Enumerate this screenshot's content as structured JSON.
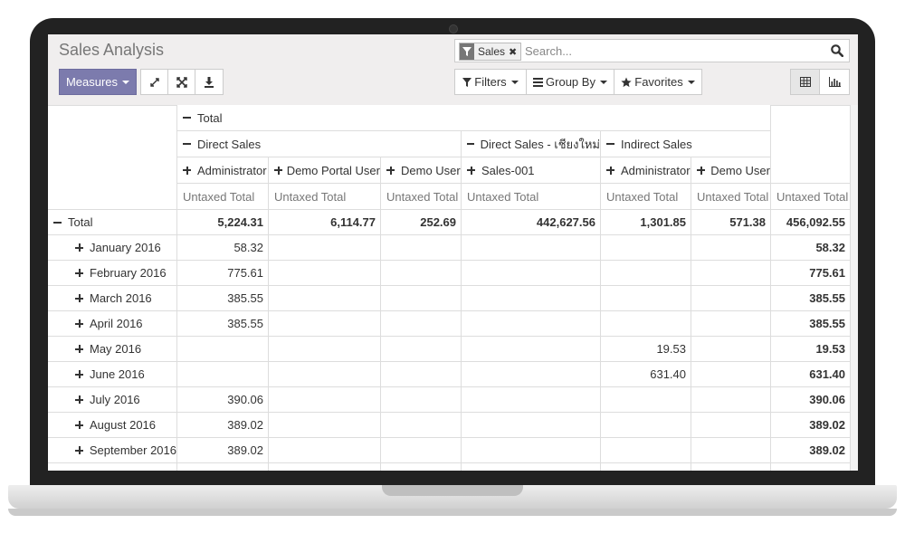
{
  "app": {
    "title": "Sales Analysis"
  },
  "toolbar": {
    "measures_label": "Measures",
    "filters_label": "Filters",
    "group_by_label": "Group By",
    "favorites_label": "Favorites"
  },
  "search": {
    "facet_value": "Sales",
    "placeholder": "Search..."
  },
  "pivot": {
    "col_total_label": "Total",
    "col_groups": [
      {
        "label": "Direct Sales",
        "expanded": true
      },
      {
        "label": "Direct Sales - เชียงใหม่",
        "expanded": true
      },
      {
        "label": "Indirect Sales",
        "expanded": true
      }
    ],
    "col_subs": [
      "Administrator",
      "Demo Portal User",
      "Demo User",
      "Sales-001",
      "Administrator",
      "Demo User"
    ],
    "measure_label": "Untaxed Total",
    "row_total_label": "Total",
    "total_row": [
      "5,224.31",
      "6,114.77",
      "252.69",
      "442,627.56",
      "1,301.85",
      "571.38",
      "456,092.55"
    ],
    "rows": [
      {
        "label": "January 2016",
        "values": [
          "58.32",
          "",
          "",
          "",
          "",
          "",
          "58.32"
        ]
      },
      {
        "label": "February 2016",
        "values": [
          "775.61",
          "",
          "",
          "",
          "",
          "",
          "775.61"
        ]
      },
      {
        "label": "March 2016",
        "values": [
          "385.55",
          "",
          "",
          "",
          "",
          "",
          "385.55"
        ]
      },
      {
        "label": "April 2016",
        "values": [
          "385.55",
          "",
          "",
          "",
          "",
          "",
          "385.55"
        ]
      },
      {
        "label": "May 2016",
        "values": [
          "",
          "",
          "",
          "",
          "19.53",
          "",
          "19.53"
        ]
      },
      {
        "label": "June 2016",
        "values": [
          "",
          "",
          "",
          "",
          "631.40",
          "",
          "631.40"
        ]
      },
      {
        "label": "July 2016",
        "values": [
          "390.06",
          "",
          "",
          "",
          "",
          "",
          "390.06"
        ]
      },
      {
        "label": "August 2016",
        "values": [
          "389.02",
          "",
          "",
          "",
          "",
          "",
          "389.02"
        ]
      },
      {
        "label": "September 2016",
        "values": [
          "389.02",
          "",
          "",
          "",
          "",
          "",
          "389.02"
        ]
      }
    ]
  },
  "colors": {
    "primary": "#7c7bad",
    "border": "#dddddd",
    "panel": "#f0eeee",
    "muted_text": "#777777"
  }
}
